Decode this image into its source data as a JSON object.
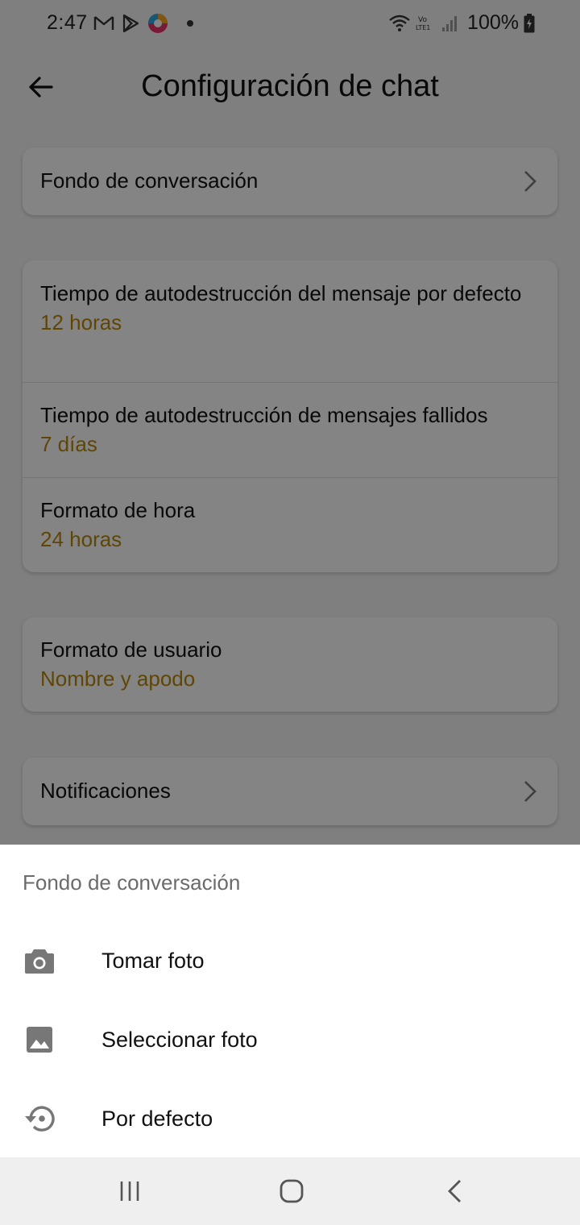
{
  "status_bar": {
    "time": "2:47",
    "battery": "100%",
    "icons": [
      "gmail-icon",
      "play-store-icon",
      "browser-icon",
      "notification-dot-icon",
      "wifi-icon",
      "volte-icon",
      "signal-icon",
      "battery-charging-icon"
    ]
  },
  "app_bar": {
    "title": "Configuración de chat",
    "back_icon": "arrow-back-icon"
  },
  "settings": {
    "wallpaper": {
      "title": "Fondo de conversación"
    },
    "self_destruct_default": {
      "title": "Tiempo de autodestrucción del mensaje por defecto",
      "value": "12 horas"
    },
    "self_destruct_failed": {
      "title": "Tiempo de autodestrucción de mensajes fallidos",
      "value": "7 días"
    },
    "time_format": {
      "title": "Formato de hora",
      "value": "24 horas"
    },
    "user_format": {
      "title": "Formato de usuario",
      "value": "Nombre y apodo"
    },
    "notifications": {
      "title": "Notificaciones"
    }
  },
  "sheet": {
    "title": "Fondo de conversación",
    "items": [
      {
        "label": "Tomar foto",
        "icon": "camera-icon"
      },
      {
        "label": "Seleccionar foto",
        "icon": "image-icon"
      },
      {
        "label": "Por defecto",
        "icon": "restore-icon"
      }
    ]
  },
  "nav_bar": {
    "icons": [
      "recent-apps-icon",
      "home-icon",
      "back-icon"
    ]
  },
  "colors": {
    "accent_value": "#b8860b",
    "scrim": "#000000"
  }
}
